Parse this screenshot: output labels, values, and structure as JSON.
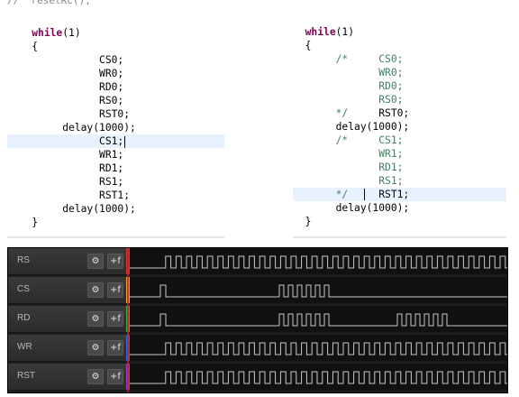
{
  "left_code": {
    "top_fragment": "//  resetRC();",
    "lines": [
      "    while(1)",
      "    {",
      "               CS0;",
      "               WR0;",
      "               RD0;",
      "               RS0;",
      "               RST0;",
      "         delay(1000);",
      "               CS1;",
      "               WR1;",
      "               RD1;",
      "               RS1;",
      "               RST1;",
      "         delay(1000);",
      "    }"
    ]
  },
  "right_code": {
    "lines": [
      "  while(1)",
      "  {",
      "       /*     CS0;",
      "              WR0;",
      "              RD0;",
      "              RS0;",
      "       */     RST0;",
      "       delay(1000);",
      "       /*     CS1;",
      "              WR1;",
      "              RD1;",
      "              RS1;",
      "       */     RST1;",
      "       delay(1000);",
      "  }"
    ]
  },
  "analyzer": {
    "buttons": {
      "gear": "⚙",
      "trigger": "+f"
    },
    "channels": [
      {
        "name": "RS",
        "color": "#d9342b"
      },
      {
        "name": "CS",
        "color": "#e0a81d"
      },
      {
        "name": "RD",
        "color": "#3fa83a"
      },
      {
        "name": "WR",
        "color": "#2f63d6"
      },
      {
        "name": "RST",
        "color": "#8b3fc8"
      }
    ]
  },
  "colors": {
    "keyword": "#7f0055",
    "comment": "#3f7f5f",
    "highlight": "#e8f2fe",
    "waveform": "#c8c8c8"
  }
}
